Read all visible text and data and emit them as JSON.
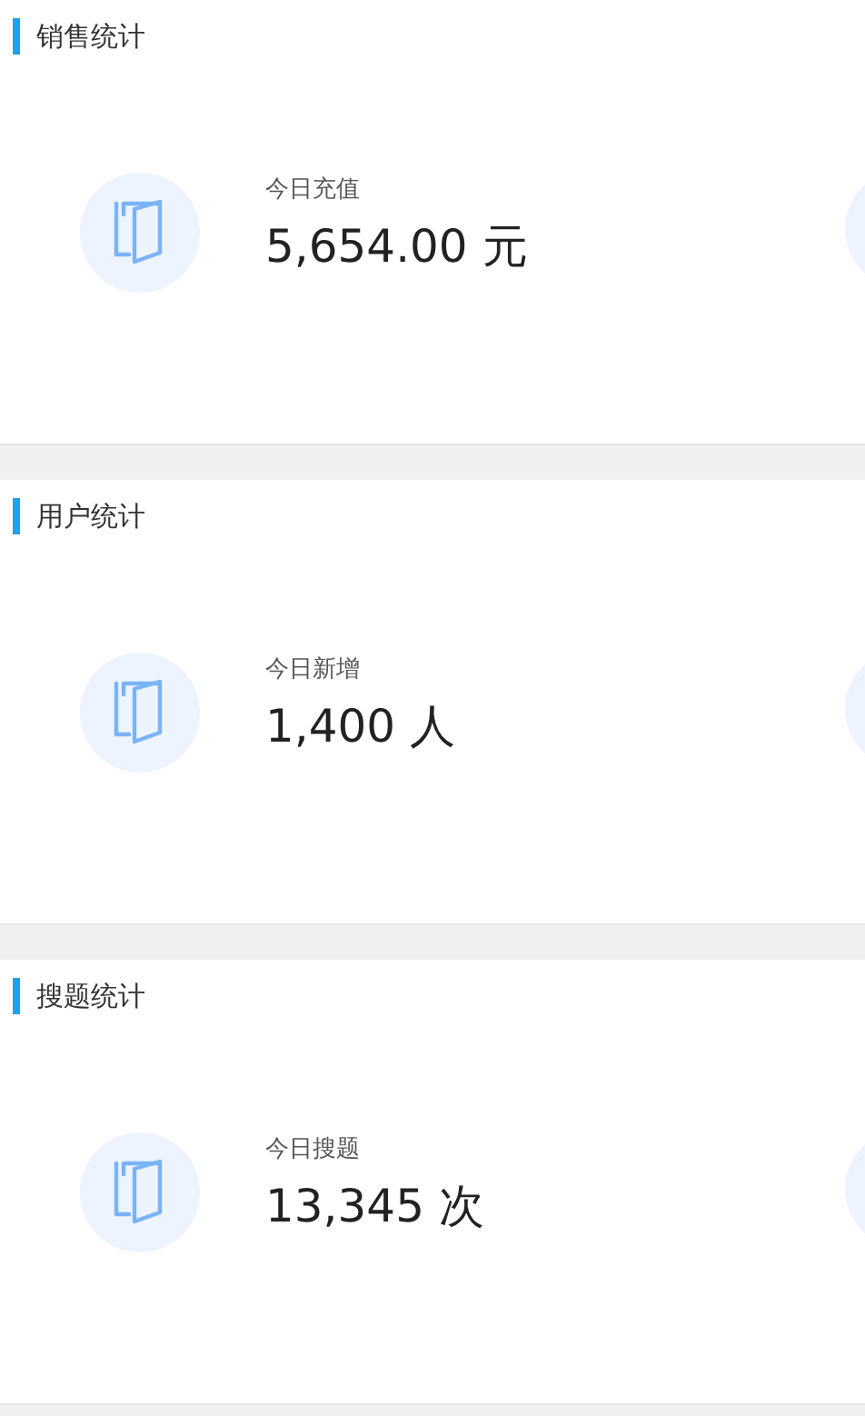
{
  "sections": [
    {
      "title": "销售统计",
      "stats": [
        {
          "label": "今日充值",
          "value": "5,654.00 元"
        }
      ]
    },
    {
      "title": "用户统计",
      "stats": [
        {
          "label": "今日新增",
          "value": "1,400 人"
        }
      ]
    },
    {
      "title": "搜题统计",
      "stats": [
        {
          "label": "今日搜题",
          "value": "13,345 次"
        }
      ]
    }
  ]
}
